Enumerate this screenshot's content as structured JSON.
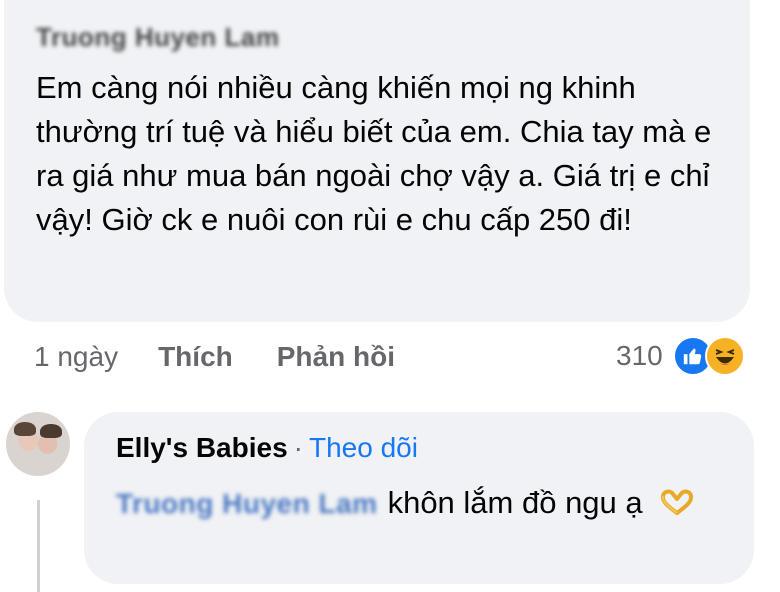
{
  "comment": {
    "author": "Truong Huyen Lam",
    "text": "Em càng nói nhiều càng khiến mọi ng khinh thường trí tuệ và hiểu biết của em. Chia tay mà e ra giá như mua bán ngoài chợ vậy a. Giá trị e chỉ vậy! Giờ ck e nuôi con rùi e chu cấp 250 đi!",
    "time": "1 ngày",
    "like_label": "Thích",
    "reply_label": "Phản hồi",
    "reaction_count": "310",
    "reaction_icons": [
      "like-icon",
      "haha-icon"
    ]
  },
  "reply": {
    "author": "Elly's Babies",
    "separator": "·",
    "follow_label": "Theo dõi",
    "mention": "Truong Huyen Lam",
    "text": "khôn lắm đồ ngu ạ",
    "emoji": "heart-hands-icon"
  },
  "colors": {
    "bubble": "#f0f2f5",
    "link": "#1877f2",
    "secondary_text": "#65676b"
  }
}
